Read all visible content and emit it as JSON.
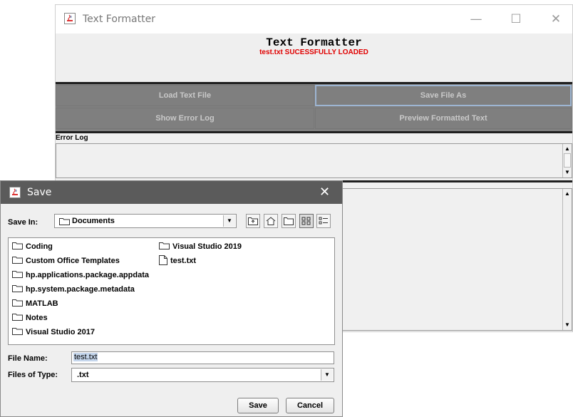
{
  "main_window": {
    "title": "Text Formatter",
    "controls": {
      "minimize": "—",
      "maximize": "☐",
      "close": "✕"
    },
    "header_title": "Text Formatter",
    "status": "test.txt SUCESSFULLY LOADED",
    "buttons": {
      "load": "Load Text File",
      "save_as": "Save File As",
      "show_error_log": "Show  Error Log",
      "preview": "Preview Formatted Text"
    },
    "error_log_label": "Error Log"
  },
  "save_dialog": {
    "title": "Save",
    "close": "✕",
    "save_in_label": "Save In:",
    "save_in_value": "Documents",
    "files": [
      {
        "name": "Coding",
        "type": "folder"
      },
      {
        "name": "Custom Office Templates",
        "type": "folder"
      },
      {
        "name": "hp.applications.package.appdata",
        "type": "folder"
      },
      {
        "name": "hp.system.package.metadata",
        "type": "folder"
      },
      {
        "name": "MATLAB",
        "type": "folder"
      },
      {
        "name": "Notes",
        "type": "folder"
      },
      {
        "name": "Visual Studio 2017",
        "type": "folder"
      },
      {
        "name": "Visual Studio 2019",
        "type": "folder"
      },
      {
        "name": "test.txt",
        "type": "file"
      }
    ],
    "file_name_label": "File Name:",
    "file_name_value": "test.txt",
    "files_of_type_label": "Files of Type:",
    "files_of_type_value": ".txt",
    "save_button": "Save",
    "cancel_button": "Cancel"
  },
  "colors": {
    "status_text": "#e00000",
    "grid_button_bg": "#7f7f7f",
    "dialog_titlebar": "#5b5b5b",
    "selection": "#c5d6ec"
  }
}
